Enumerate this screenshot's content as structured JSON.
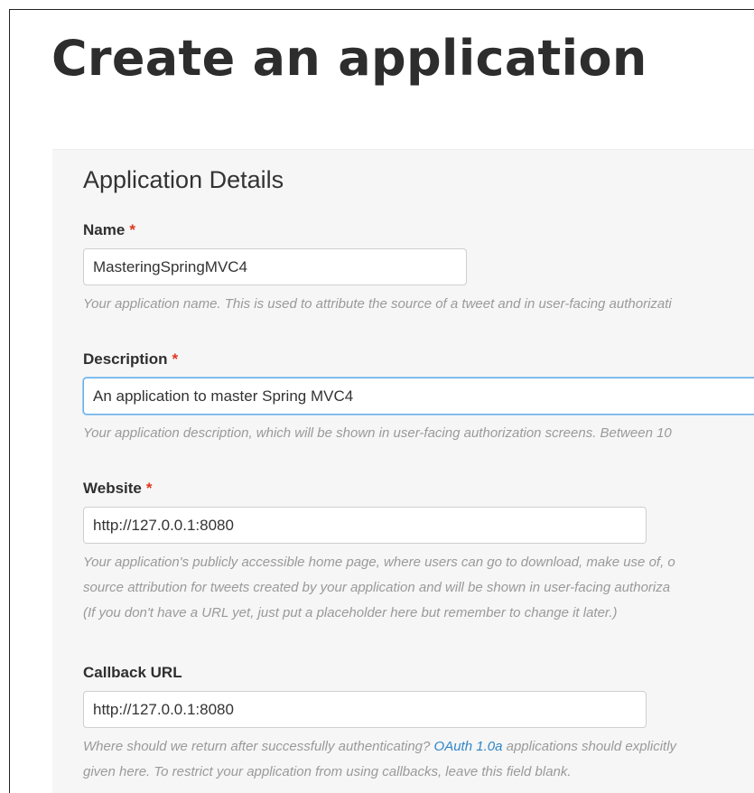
{
  "page": {
    "title": "Create an application"
  },
  "form": {
    "section_title": "Application Details",
    "required_marker": "*",
    "name": {
      "label": "Name",
      "value": "MasteringSpringMVC4",
      "help": "Your application name. This is used to attribute the source of a tweet and in user-facing authorizati"
    },
    "description": {
      "label": "Description",
      "value": "An application to master Spring MVC4",
      "help": "Your application description, which will be shown in user-facing authorization screens. Between 10"
    },
    "website": {
      "label": "Website",
      "value": "http://127.0.0.1:8080",
      "help_lines": [
        "Your application's publicly accessible home page, where users can go to download, make use of, o",
        "source attribution for tweets created by your application and will be shown in user-facing authoriza",
        "(If you don't have a URL yet, just put a placeholder here but remember to change it later.)"
      ]
    },
    "callback": {
      "label": "Callback URL",
      "value": "http://127.0.0.1:8080",
      "help_before_link": "Where should we return after successfully authenticating? ",
      "help_link": "OAuth 1.0a",
      "help_after_link": " applications should explicitly",
      "help_line2": "given here. To restrict your application from using callbacks, leave this field blank."
    }
  }
}
